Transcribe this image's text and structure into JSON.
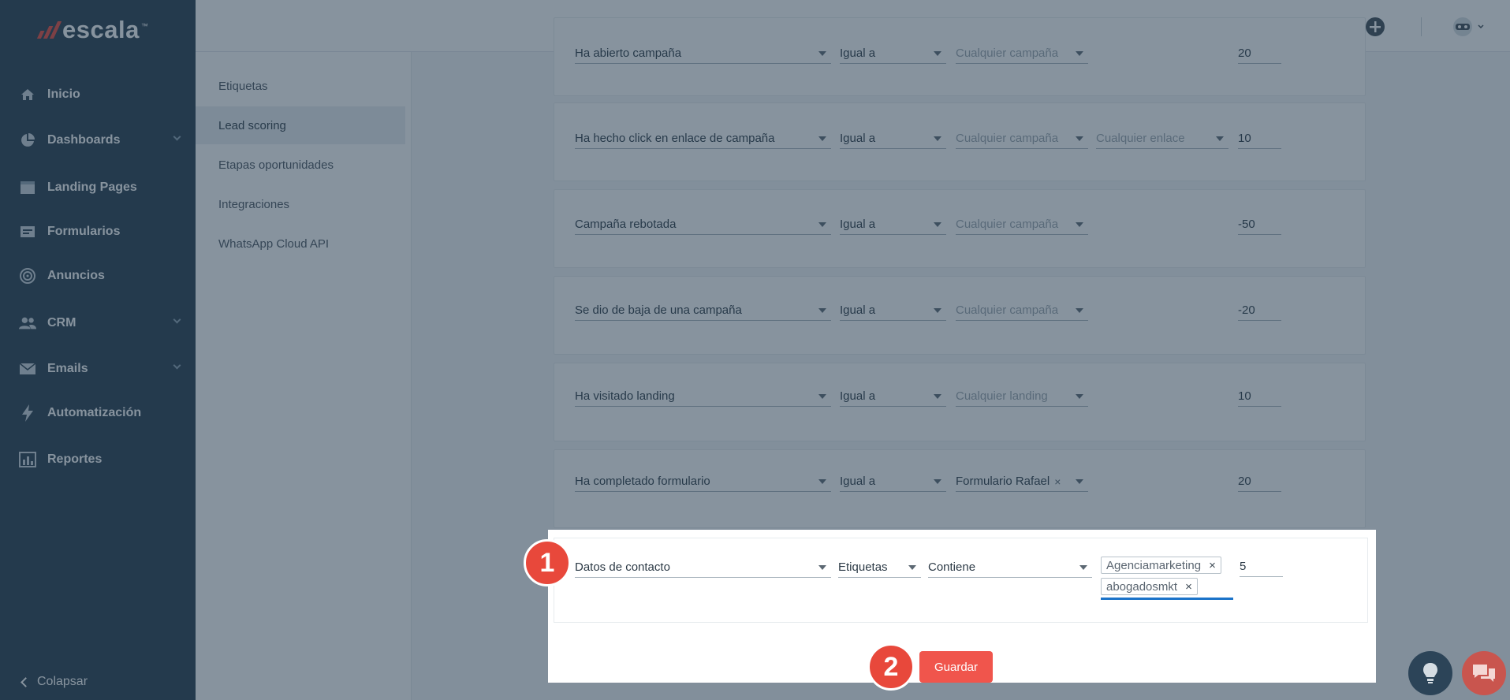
{
  "brand": {
    "name": "escala",
    "tm": "™",
    "accent": "#e8483b"
  },
  "sidebar": {
    "items": [
      {
        "label": "Inicio",
        "icon": "home-icon"
      },
      {
        "label": "Dashboards",
        "icon": "pie-chart-icon",
        "expandable": true
      },
      {
        "label": "Landing Pages",
        "icon": "landing-page-icon"
      },
      {
        "label": "Formularios",
        "icon": "form-icon"
      },
      {
        "label": "Anuncios",
        "icon": "target-icon"
      },
      {
        "label": "CRM",
        "icon": "people-icon",
        "expandable": true
      },
      {
        "label": "Emails",
        "icon": "envelope-icon",
        "expandable": true
      },
      {
        "label": "Automatización",
        "icon": "lightning-icon"
      },
      {
        "label": "Reportes",
        "icon": "bar-chart-icon"
      }
    ],
    "collapse_label": "Colapsar"
  },
  "settings_menu": {
    "items": [
      {
        "label": "Etiquetas",
        "active": false
      },
      {
        "label": "Lead scoring",
        "active": true
      },
      {
        "label": "Etapas oportunidades",
        "active": false
      },
      {
        "label": "Integraciones",
        "active": false
      },
      {
        "label": "WhatsApp Cloud API",
        "active": false
      }
    ]
  },
  "rules": [
    {
      "event": "Ha abierto campaña",
      "operator": "Igual a",
      "target": "Cualquier campaña",
      "extra": "",
      "points": "20"
    },
    {
      "event": "Ha hecho click en enlace de campaña",
      "operator": "Igual a",
      "target": "Cualquier campaña",
      "extra": "Cualquier enlace",
      "points": "10"
    },
    {
      "event": "Campaña rebotada",
      "operator": "Igual a",
      "target": "Cualquier campaña",
      "extra": "",
      "points": "-50"
    },
    {
      "event": "Se dio de baja de una campaña",
      "operator": "Igual a",
      "target": "Cualquier campaña",
      "extra": "",
      "points": "-20"
    },
    {
      "event": "Ha visitado landing",
      "operator": "Igual a",
      "target": "Cualquier landing",
      "extra": "",
      "points": "10"
    },
    {
      "event": "Ha completado formulario",
      "operator": "Igual a",
      "target": "Formulario Rafael",
      "extra": "",
      "points": "20"
    }
  ],
  "highlighted_rule": {
    "event": "Datos de contacto",
    "field": "Etiquetas",
    "operator": "Contiene",
    "tags": [
      "Agenciamarketing",
      "abogadosmkt"
    ],
    "remove_glyph": "×",
    "points": "5"
  },
  "markers": {
    "one": "1",
    "two": "2"
  },
  "save_label": "Guardar"
}
